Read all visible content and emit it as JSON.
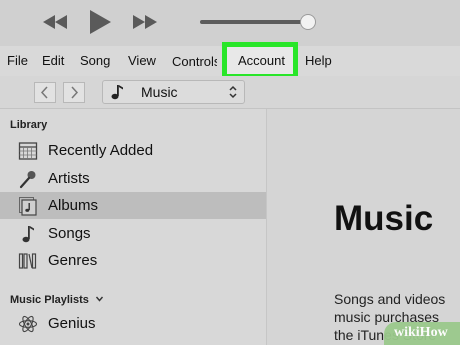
{
  "menu": {
    "items": [
      "File",
      "Edit",
      "Song",
      "View",
      "Controls",
      "Account",
      "Help"
    ],
    "highlighted": "Account",
    "highlight_color": "#29e629"
  },
  "toolbar": {
    "media_label": "Music",
    "media_icon": "music-note-icon"
  },
  "sidebar": {
    "library_label": "Library",
    "library_items": [
      {
        "label": "Recently Added",
        "icon": "calendar-grid-icon"
      },
      {
        "label": "Artists",
        "icon": "microphone-icon"
      },
      {
        "label": "Albums",
        "icon": "album-icon",
        "selected": true
      },
      {
        "label": "Songs",
        "icon": "music-note-icon"
      },
      {
        "label": "Genres",
        "icon": "genres-icon"
      }
    ],
    "playlists_label": "Music Playlists",
    "playlist_items": [
      {
        "label": "Genius",
        "icon": "atom-icon"
      }
    ]
  },
  "main": {
    "title": "Music",
    "text_lines": [
      "Songs and videos",
      "music purchases",
      "the iTunes Store"
    ]
  },
  "watermark": {
    "text": "wikiHow"
  }
}
